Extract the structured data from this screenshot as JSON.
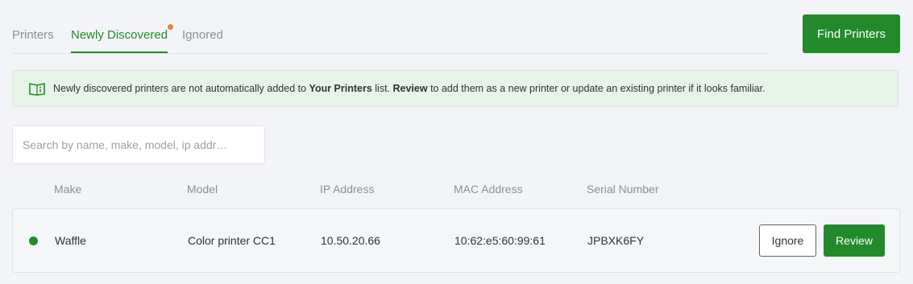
{
  "tabs": [
    {
      "label": "Printers",
      "active": false
    },
    {
      "label": "Newly Discovered",
      "active": true,
      "has_notification": true
    },
    {
      "label": "Ignored",
      "active": false
    }
  ],
  "find_button": "Find Printers",
  "notice": {
    "text_1": "Newly discovered printers are not automatically added to ",
    "bold_1": "Your Printers",
    "text_2": " list. ",
    "bold_2": "Review",
    "text_3": " to add them as a new printer or update an existing printer if it looks familiar.",
    "icon": "info-book-icon"
  },
  "search": {
    "placeholder": "Search by name, make, model, ip addr…",
    "value": ""
  },
  "table": {
    "headers": {
      "make": "Make",
      "model": "Model",
      "ip": "IP Address",
      "mac": "MAC Address",
      "serial": "Serial Number"
    },
    "rows": [
      {
        "status": "online",
        "make": "Waffle",
        "model": "Color printer CC1",
        "ip": "10.50.20.66",
        "mac": "10:62:e5:60:99:61",
        "serial": "JPBXK6FY",
        "ignore_label": "Ignore",
        "review_label": "Review"
      }
    ]
  },
  "colors": {
    "accent": "#238a2c",
    "notification": "#ec8338",
    "notice_bg": "#e7f3e8"
  }
}
